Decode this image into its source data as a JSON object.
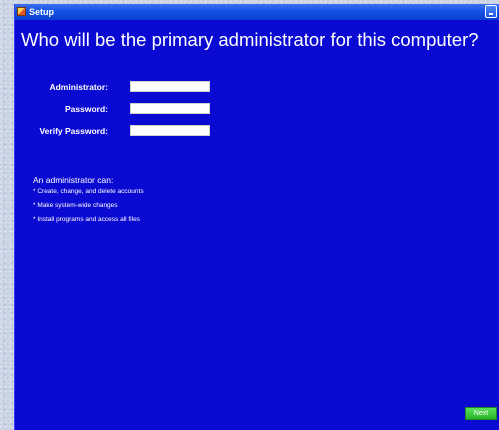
{
  "window": {
    "title": "Setup",
    "icon": "setup-icon",
    "minimize_icon": "minimize-icon"
  },
  "heading": "Who will be the primary administrator for this computer?",
  "form": {
    "fields": [
      {
        "label": "Administrator:",
        "value": ""
      },
      {
        "label": "Password:",
        "value": ""
      },
      {
        "label": "Verify Password:",
        "value": ""
      }
    ]
  },
  "info": {
    "heading": "An administrator can:",
    "items": [
      "* Create, change, and delete accounts",
      "* Make system-wide changes",
      "* Install programs and access all files"
    ]
  },
  "footer": {
    "next_label": "Next"
  },
  "colors": {
    "background": "#0a0ad2",
    "titlebar": "#1453e6",
    "next_button": "#27b427"
  }
}
